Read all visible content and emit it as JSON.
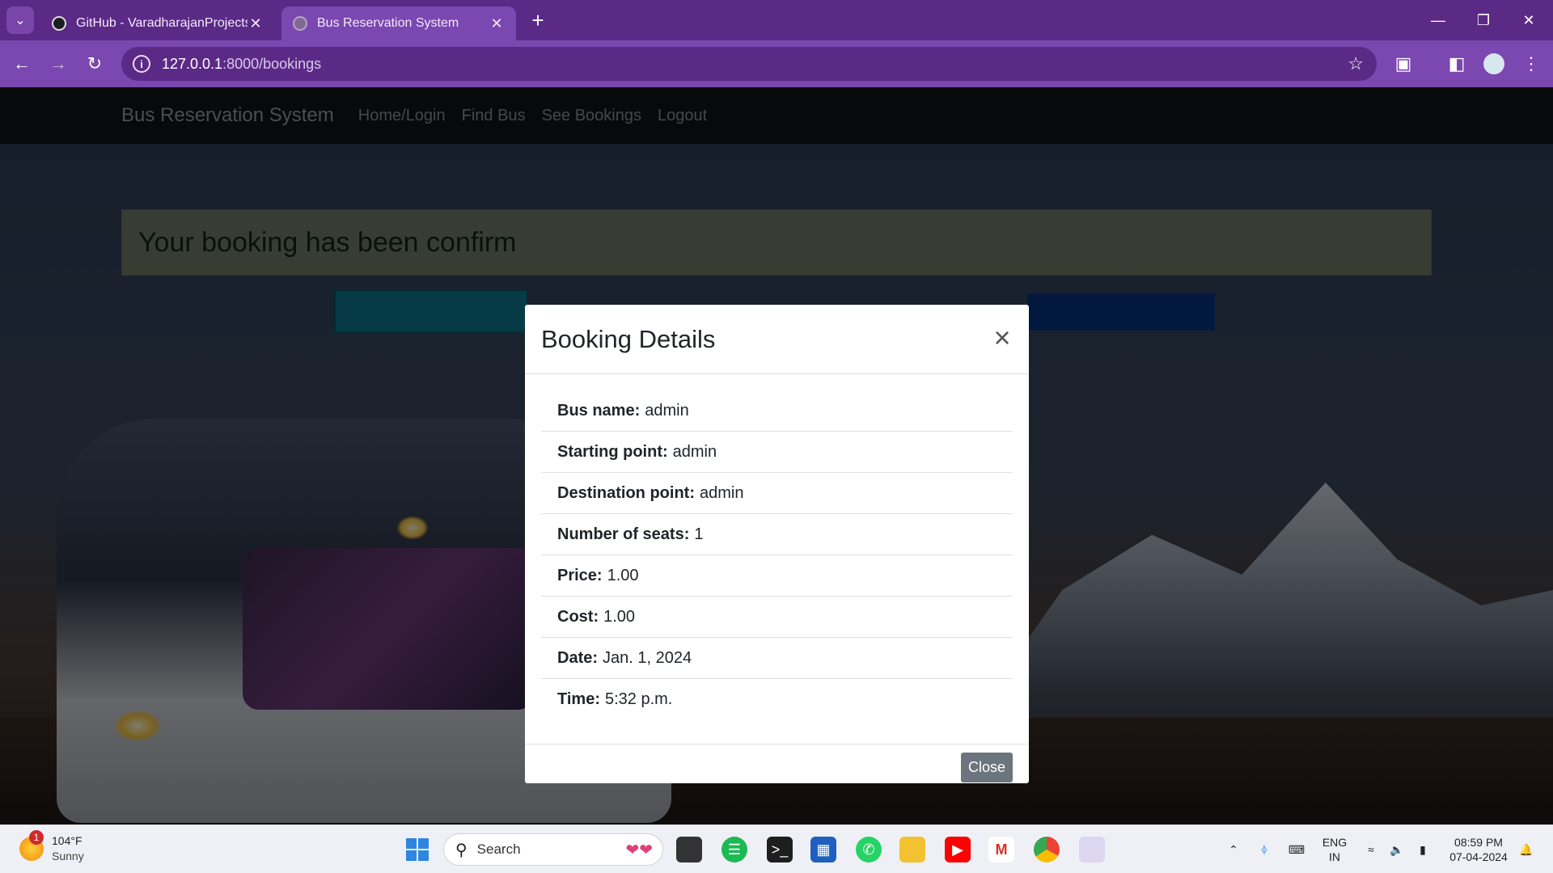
{
  "browser": {
    "tabs": [
      {
        "title": "GitHub - VaradharajanProjects/",
        "active": false
      },
      {
        "title": "Bus Reservation System",
        "active": true
      }
    ],
    "url_host": "127.0.0.1",
    "url_path": ":8000/bookings"
  },
  "navbar": {
    "brand": "Bus Reservation System",
    "links": [
      "Home/Login",
      "Find Bus",
      "See Bookings",
      "Logout"
    ]
  },
  "alert": {
    "text": "Your booking has been confirm"
  },
  "modal": {
    "title": "Booking Details",
    "close_label": "Close",
    "details": [
      {
        "label": "Bus name:",
        "value": "admin"
      },
      {
        "label": "Starting point:",
        "value": "admin"
      },
      {
        "label": "Destination point:",
        "value": "admin"
      },
      {
        "label": "Number of seats:",
        "value": "1"
      },
      {
        "label": "Price:",
        "value": "1.00"
      },
      {
        "label": "Cost:",
        "value": "1.00"
      },
      {
        "label": "Date:",
        "value": "Jan. 1, 2024"
      },
      {
        "label": "Time:",
        "value": "5:32 p.m."
      }
    ]
  },
  "taskbar": {
    "weather_temp": "104°F",
    "weather_desc": "Sunny",
    "weather_badge": "1",
    "search_placeholder": "Search",
    "lang_top": "ENG",
    "lang_bottom": "IN",
    "time": "08:59 PM",
    "date": "07-04-2024"
  },
  "colors": {
    "browser_frame": "#5b2a86",
    "browser_toolbar": "#7b47b0",
    "navbar": "#111214",
    "close_button": "#6c757d"
  }
}
